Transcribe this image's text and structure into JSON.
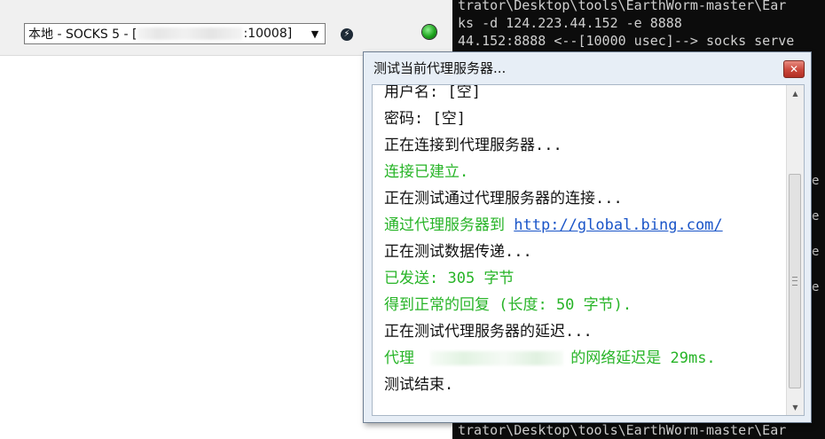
{
  "toolbar": {
    "proxy_prefix": "本地 - SOCKS 5 - [",
    "proxy_suffix": ":10008]"
  },
  "terminal": {
    "line1": "trator\\Desktop\\tools\\EarthWorm-master\\Ear",
    "line2": "ks -d 124.223.44.152 -e 8888",
    "line3": "44.152:8888 <--[10000 usec]--> socks serve",
    "line_bottom": "trator\\Desktop\\tools\\EarthWorm-master\\Ear",
    "right_fragments": [
      "e",
      "e",
      "e",
      "e"
    ]
  },
  "dialog": {
    "title": "测试当前代理服务器...",
    "lines": [
      "用户名: [空]",
      "密码: [空]",
      "正在连接到代理服务器...",
      "连接已建立.",
      "正在测试通过代理服务器的连接...",
      "通过代理服务器到 ",
      "正在测试数据传递...",
      "已发送: 305 字节",
      "得到正常的回复 (长度: 50 字节).",
      "正在测试代理服务器的延迟...",
      "代理 ",
      "测试结束."
    ],
    "link": "http://global.bing.com/",
    "latency_suffix": "的网络延迟是 29ms."
  },
  "colors": {
    "success_green": "#27b427",
    "link_blue": "#1a55c8",
    "status_led": "#1ea41e"
  },
  "icons": {
    "flash": "lightning-icon",
    "status": "status-indicator-icon",
    "close": "close-icon"
  }
}
